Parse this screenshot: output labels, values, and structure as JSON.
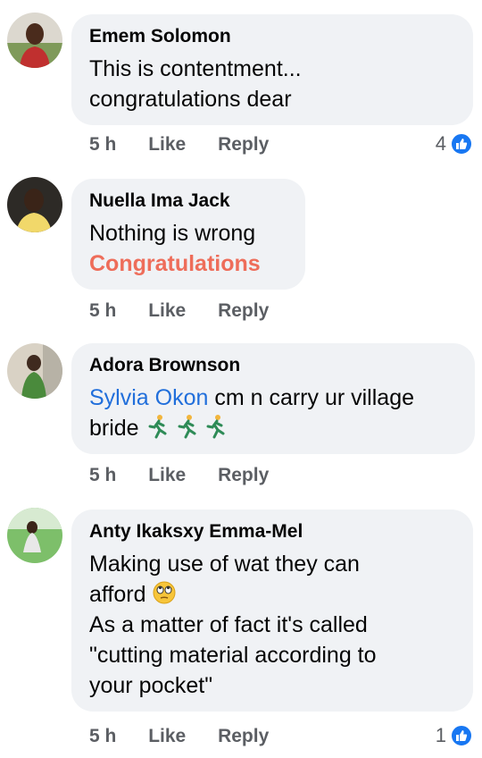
{
  "comments": [
    {
      "author": "Emem Solomon",
      "lines": [
        "This is contentment...",
        "congratulations dear"
      ],
      "time": "5 h",
      "like_label": "Like",
      "reply_label": "Reply",
      "reaction_count": "4"
    },
    {
      "author": "Nuella Ima Jack",
      "lines": [
        "Nothing is wrong",
        "Congratulations"
      ],
      "time": "5 h",
      "like_label": "Like",
      "reply_label": "Reply"
    },
    {
      "author": "Adora Brownson",
      "mention": "Sylvia Okon",
      "lines": [
        " cm n carry ur village",
        "bride"
      ],
      "emojis": [
        "runner-icon",
        "runner-icon",
        "runner-icon"
      ],
      "time": "5 h",
      "like_label": "Like",
      "reply_label": "Reply"
    },
    {
      "author": "Anty Ikaksxy Emma-Mel",
      "lines": [
        "Making use of wat they can",
        "afford",
        "As a matter of fact it's called",
        "\"cutting material according to",
        "your pocket\""
      ],
      "emoji": "eye-roll-face-icon",
      "time": "5 h",
      "like_label": "Like",
      "reply_label": "Reply",
      "reaction_count": "1"
    }
  ],
  "colors": {
    "bubble": "#f0f2f5",
    "mention": "#216fdb",
    "highlight": "#ee6d5a",
    "like_blue": "#1877f2",
    "meta": "#5b5e63"
  }
}
